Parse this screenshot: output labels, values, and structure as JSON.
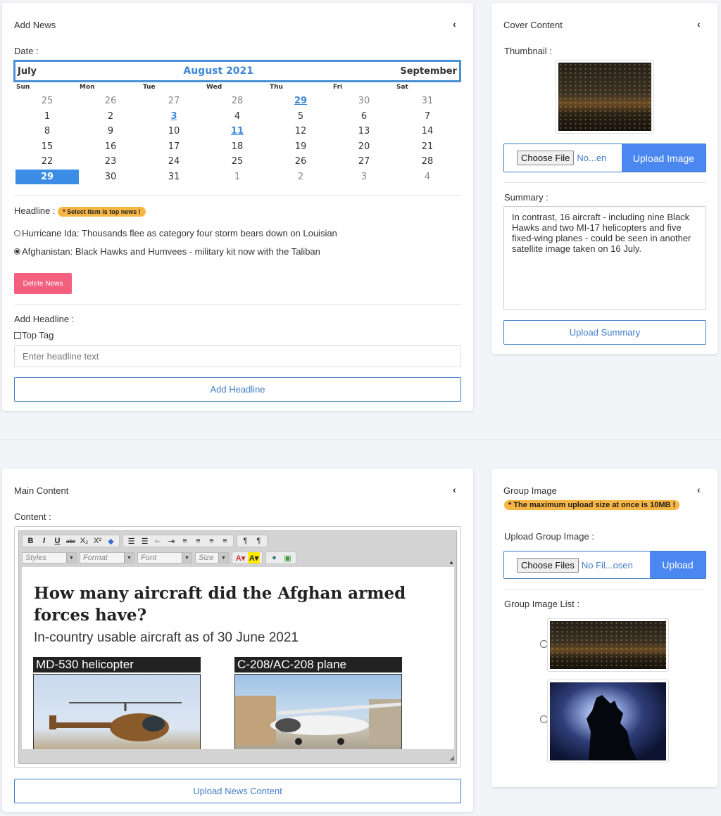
{
  "add_news": {
    "title": "Add News",
    "date_label": "Date :",
    "calendar": {
      "prev": "July",
      "month": "August 2021",
      "next": "September",
      "dow": [
        "Sun",
        "Mon",
        "Tue",
        "Wed",
        "Thu",
        "Fri",
        "Sat"
      ],
      "weeks": [
        [
          {
            "d": "25",
            "s": "other"
          },
          {
            "d": "26",
            "s": "other"
          },
          {
            "d": "27",
            "s": "other"
          },
          {
            "d": "28",
            "s": "other"
          },
          {
            "d": "29",
            "s": "event"
          },
          {
            "d": "30",
            "s": "other"
          },
          {
            "d": "31",
            "s": "other"
          }
        ],
        [
          {
            "d": "1"
          },
          {
            "d": "2"
          },
          {
            "d": "3",
            "s": "event"
          },
          {
            "d": "4"
          },
          {
            "d": "5"
          },
          {
            "d": "6"
          },
          {
            "d": "7"
          }
        ],
        [
          {
            "d": "8"
          },
          {
            "d": "9"
          },
          {
            "d": "10"
          },
          {
            "d": "11",
            "s": "event"
          },
          {
            "d": "12"
          },
          {
            "d": "13"
          },
          {
            "d": "14"
          }
        ],
        [
          {
            "d": "15"
          },
          {
            "d": "16"
          },
          {
            "d": "17"
          },
          {
            "d": "18"
          },
          {
            "d": "19"
          },
          {
            "d": "20"
          },
          {
            "d": "21"
          }
        ],
        [
          {
            "d": "22"
          },
          {
            "d": "23"
          },
          {
            "d": "24"
          },
          {
            "d": "25"
          },
          {
            "d": "26"
          },
          {
            "d": "27"
          },
          {
            "d": "28"
          }
        ],
        [
          {
            "d": "29",
            "s": "sel"
          },
          {
            "d": "30"
          },
          {
            "d": "31"
          },
          {
            "d": "1",
            "s": "other"
          },
          {
            "d": "2",
            "s": "other"
          },
          {
            "d": "3",
            "s": "other"
          },
          {
            "d": "4",
            "s": "other"
          }
        ]
      ]
    },
    "headline_label": "Headline :",
    "headline_badge": "* Select item is top news !",
    "headlines": [
      {
        "text": "Hurricane Ida: Thousands flee as category four storm bears down on Louisian",
        "checked": false
      },
      {
        "text": "Afghanistan: Black Hawks and Humvees - military kit now with the Taliban",
        "checked": true
      }
    ],
    "delete_button": "Delete News",
    "add_headline_label": "Add Headline :",
    "top_tag_label": "Top Tag",
    "headline_placeholder": "Enter headline text",
    "add_headline_button": "Add Headline"
  },
  "cover": {
    "title": "Cover Content",
    "thumbnail_label": "Thumbnail :",
    "choose_file": "Choose File",
    "file_chosen": "No...en",
    "upload_image": "Upload Image",
    "summary_label": "Summary :",
    "summary_text": "In contrast, 16 aircraft - including nine Black Hawks and two MI-17 helicopters and five fixed-wing planes - could be seen in another satellite image taken on 16 July.",
    "upload_summary": "Upload Summary"
  },
  "main_content": {
    "title": "Main Content",
    "content_label": "Content :",
    "toolbar": {
      "bold": "B",
      "italic": "I",
      "underline": "U",
      "strike": "abc",
      "sub": "X₂",
      "sup": "X²",
      "styles": "Styles",
      "format": "Format",
      "font": "Font",
      "size": "Size"
    },
    "article": {
      "heading": "How many aircraft did the Afghan armed forces have?",
      "subheading": "In-country usable aircraft as of 30 June 2021",
      "caption1": "MD-530 helicopter",
      "caption2": "C-208/AC-208 plane"
    },
    "upload_button": "Upload News Content"
  },
  "group_image": {
    "title": "Group Image",
    "badge": "* The maximum upload size at once is 10MB !",
    "upload_label": "Upload Group Image :",
    "choose_files": "Choose Files",
    "files_chosen": "No Fil...osen",
    "upload_button": "Upload",
    "list_label": "Group Image List :"
  }
}
